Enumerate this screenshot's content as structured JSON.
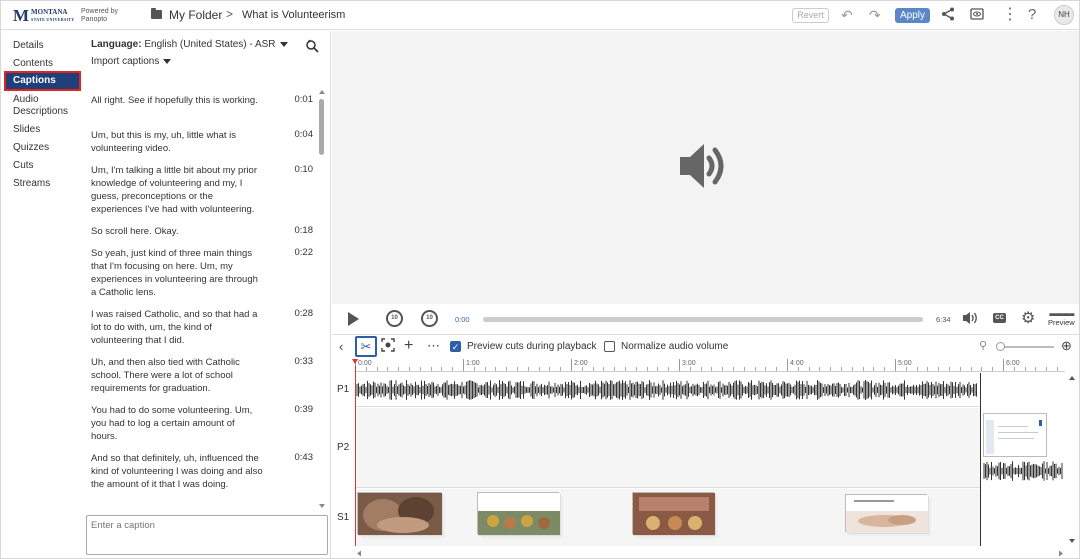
{
  "header": {
    "logo_letter": "M",
    "logo_name": "MONTANA",
    "logo_sub": "STATE UNIVERSITY",
    "powered_line1": "Powered by",
    "powered_line2": "Panopto",
    "folder": "My Folder",
    "separator": ">",
    "title": "What is Volunteerism",
    "revert_label": "Revert",
    "apply_label": "Apply",
    "avatar_initials": "NH"
  },
  "nav": {
    "items": [
      {
        "label": "Details"
      },
      {
        "label": "Contents"
      },
      {
        "label": "Captions"
      },
      {
        "label": "Audio Descriptions"
      },
      {
        "label": "Slides"
      },
      {
        "label": "Quizzes"
      },
      {
        "label": "Cuts"
      },
      {
        "label": "Streams"
      }
    ],
    "active": "Captions"
  },
  "captions": {
    "language_label": "Language:",
    "language_value": "English (United States) - ASR",
    "import_label": "Import captions",
    "input_placeholder": "Enter a caption",
    "items": [
      {
        "text": "All right. See if hopefully this is working.",
        "time": "0:01"
      },
      {
        "text": "Um, but this is my, uh, little what is volunteering video.",
        "time": "0:04"
      },
      {
        "text": "Um, I'm talking a little bit about my prior knowledge of volunteering and my, I guess, preconceptions or the experiences I've had with volunteering.",
        "time": "0:10"
      },
      {
        "text": "So scroll here. Okay.",
        "time": "0:18"
      },
      {
        "text": "So yeah, just kind of three main things that I'm focusing on here. Um, my experiences in volunteering are through a Catholic lens.",
        "time": "0:22"
      },
      {
        "text": "I was raised Catholic, and so that had a lot to do with, um, the kind of volunteering that I did.",
        "time": "0:28"
      },
      {
        "text": "Uh, and then also tied with Catholic school. There were a lot of school requirements for graduation.",
        "time": "0:33"
      },
      {
        "text": "You had to do some volunteering. Um, you had to log a certain amount of hours.",
        "time": "0:39"
      },
      {
        "text": "And so that definitely, uh, influenced the kind of volunteering I was doing and also the amount of it that I was doing.",
        "time": "0:43"
      }
    ]
  },
  "player": {
    "skip_back_label": "10",
    "skip_forward_label": "10",
    "current_time": "0:00",
    "duration": "6:34",
    "progress_fraction": 0.0,
    "cc_label": "CC",
    "preview_label": "Preview"
  },
  "toolbar": {
    "preview_cuts_label": "Preview cuts during playback",
    "preview_cuts_checked": true,
    "normalize_label": "Normalize audio volume",
    "normalize_checked": false
  },
  "timeline": {
    "ruler_labels": [
      "0:00",
      "1:00",
      "2:00",
      "3:00",
      "4:00",
      "5:00",
      "6:00"
    ],
    "tracks": [
      "P1",
      "P2",
      "S1"
    ]
  },
  "colors": {
    "nav_active_bg": "#1f3f7a",
    "nav_active_border": "#e0251f",
    "apply_bg": "#5b87c7",
    "accent_blue": "#2f5ea8",
    "playhead": "#d33333"
  }
}
